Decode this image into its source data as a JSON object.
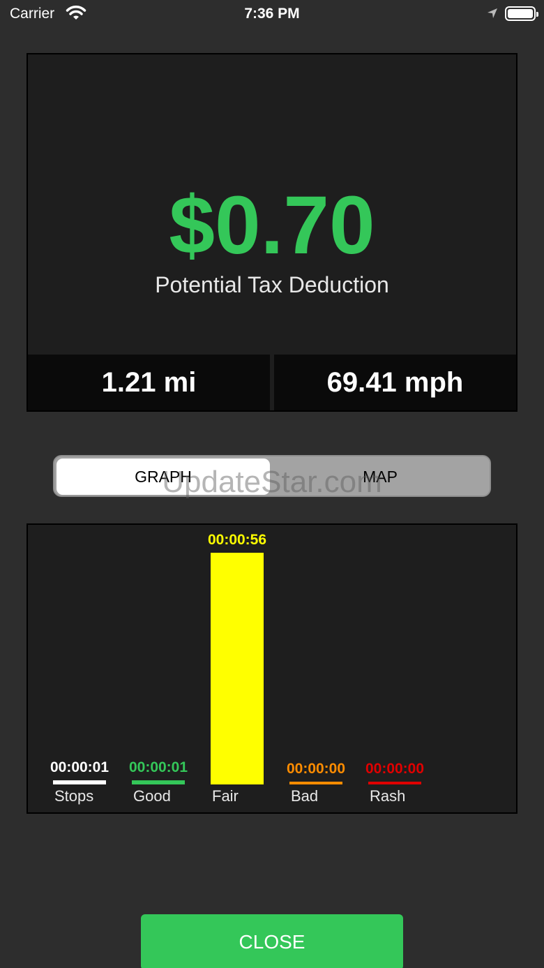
{
  "status_bar": {
    "carrier": "Carrier",
    "time": "7:36 PM",
    "icons": [
      "wifi-icon",
      "location-arrow-icon",
      "battery-icon"
    ]
  },
  "summary": {
    "amount": "$0.70",
    "amount_color": "#34c759",
    "label": "Potential Tax Deduction",
    "distance": "1.21 mi",
    "speed": "69.41 mph"
  },
  "segmented": {
    "options": [
      "GRAPH",
      "MAP"
    ],
    "selected": "GRAPH"
  },
  "watermark": "UpdateStar.com",
  "chart_data": {
    "type": "bar",
    "unit": "seconds",
    "categories": [
      "Stops",
      "Good",
      "Fair",
      "Bad",
      "Rash"
    ],
    "values": [
      1,
      1,
      56,
      0,
      0
    ],
    "value_labels": [
      "00:00:01",
      "00:00:01",
      "00:00:56",
      "00:00:00",
      "00:00:00"
    ],
    "colors": [
      "#ffffff",
      "#34c759",
      "#ffff00",
      "#ff8c00",
      "#e00000"
    ],
    "ylim": [
      0,
      56
    ],
    "grid": false,
    "legend": "none"
  },
  "close_button": {
    "label": "CLOSE"
  }
}
